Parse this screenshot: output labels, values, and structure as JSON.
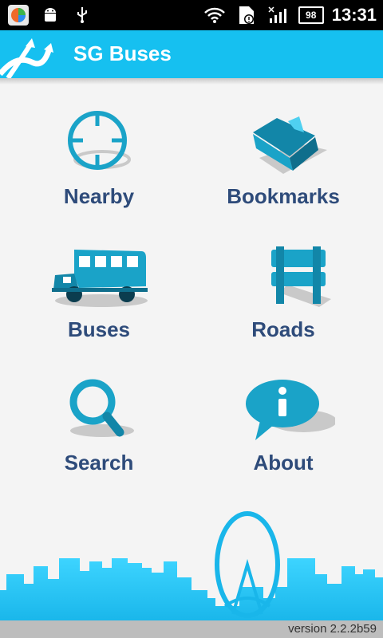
{
  "status_bar": {
    "battery": "98",
    "time": "13:31"
  },
  "app": {
    "title": "SG Buses"
  },
  "menu": [
    {
      "label": "Nearby",
      "icon": "crosshair-icon"
    },
    {
      "label": "Bookmarks",
      "icon": "folder-icon"
    },
    {
      "label": "Buses",
      "icon": "bus-icon"
    },
    {
      "label": "Roads",
      "icon": "signpost-icon"
    },
    {
      "label": "Search",
      "icon": "magnifier-icon"
    },
    {
      "label": "About",
      "icon": "info-bubble-icon"
    }
  ],
  "footer": {
    "version": "version 2.2.2b59"
  },
  "colors": {
    "accent": "#16c0f0",
    "label": "#2e4b7a",
    "icon": "#1aa3c8"
  }
}
